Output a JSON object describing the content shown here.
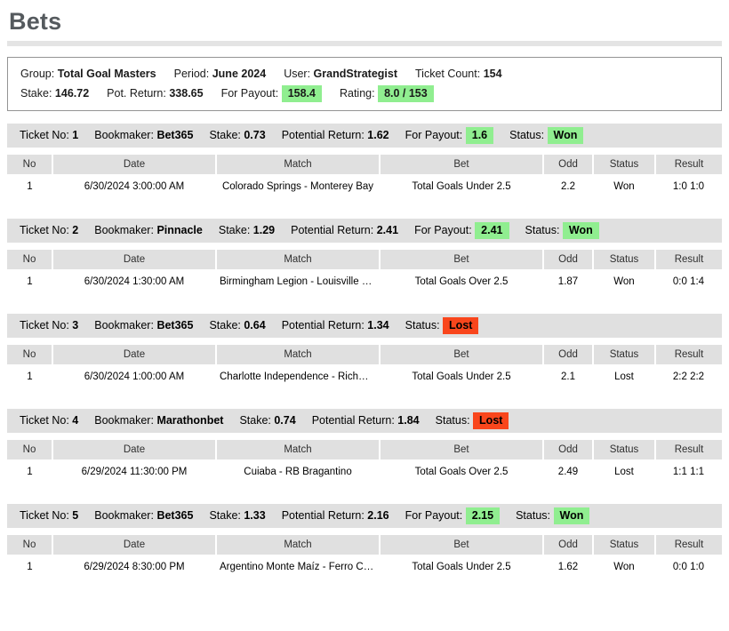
{
  "page": {
    "title": "Bets"
  },
  "summary": {
    "group_label": "Group:",
    "group_value": "Total Goal Masters",
    "period_label": "Period:",
    "period_value": "June 2024",
    "user_label": "User:",
    "user_value": "GrandStrategist",
    "ticket_count_label": "Ticket Count:",
    "ticket_count_value": "154",
    "stake_label": "Stake:",
    "stake_value": "146.72",
    "pot_return_label": "Pot. Return:",
    "pot_return_value": "338.65",
    "for_payout_label": "For Payout:",
    "for_payout_value": "158.4",
    "rating_label": "Rating:",
    "rating_value": "8.0 / 153"
  },
  "labels": {
    "ticket_no": "Ticket No:",
    "bookmaker": "Bookmaker:",
    "stake": "Stake:",
    "potential_return": "Potential Return:",
    "for_payout": "For Payout:",
    "status": "Status:"
  },
  "columns": {
    "no": "No",
    "date": "Date",
    "match": "Match",
    "bet": "Bet",
    "odd": "Odd",
    "status": "Status",
    "result": "Result"
  },
  "colors": {
    "accent_green": "#90ee90",
    "accent_red": "#f9461c",
    "won_text": "#1f9c2d",
    "lost_text": "#e02020",
    "header_grey": "#e0e0e0",
    "title_grey": "#555a5e"
  },
  "tickets": [
    {
      "ticket_no": "1",
      "bookmaker": "Bet365",
      "stake": "0.73",
      "potential_return": "1.62",
      "for_payout": "1.6",
      "status": "Won",
      "rows": [
        {
          "no": "1",
          "date": "6/30/2024 3:00:00 AM",
          "match": "Colorado Springs - Monterey Bay",
          "bet": "Total Goals Under 2.5",
          "odd": "2.2",
          "status": "Won",
          "result": "1:0 1:0"
        }
      ]
    },
    {
      "ticket_no": "2",
      "bookmaker": "Pinnacle",
      "stake": "1.29",
      "potential_return": "2.41",
      "for_payout": "2.41",
      "status": "Won",
      "rows": [
        {
          "no": "1",
          "date": "6/30/2024 1:30:00 AM",
          "match": "Birmingham Legion - Louisville City",
          "bet": "Total Goals Over 2.5",
          "odd": "1.87",
          "status": "Won",
          "result": "0:0 1:4"
        }
      ]
    },
    {
      "ticket_no": "3",
      "bookmaker": "Bet365",
      "stake": "0.64",
      "potential_return": "1.34",
      "for_payout": null,
      "status": "Lost",
      "rows": [
        {
          "no": "1",
          "date": "6/30/2024 1:00:00 AM",
          "match": "Charlotte Independence - Richmond Kickers",
          "bet": "Total Goals Under 2.5",
          "odd": "2.1",
          "status": "Lost",
          "result": "2:2 2:2"
        }
      ]
    },
    {
      "ticket_no": "4",
      "bookmaker": "Marathonbet",
      "stake": "0.74",
      "potential_return": "1.84",
      "for_payout": null,
      "status": "Lost",
      "rows": [
        {
          "no": "1",
          "date": "6/29/2024 11:30:00 PM",
          "match": "Cuiaba - RB Bragantino",
          "bet": "Total Goals Over 2.5",
          "odd": "2.49",
          "status": "Lost",
          "result": "1:1 1:1"
        }
      ]
    },
    {
      "ticket_no": "5",
      "bookmaker": "Bet365",
      "stake": "1.33",
      "potential_return": "2.16",
      "for_payout": "2.15",
      "status": "Won",
      "rows": [
        {
          "no": "1",
          "date": "6/29/2024 8:30:00 PM",
          "match": "Argentino Monte Maíz - Ferro Carril Oeste LP",
          "bet": "Total Goals Under 2.5",
          "odd": "1.62",
          "status": "Won",
          "result": "0:0 1:0"
        }
      ]
    }
  ]
}
